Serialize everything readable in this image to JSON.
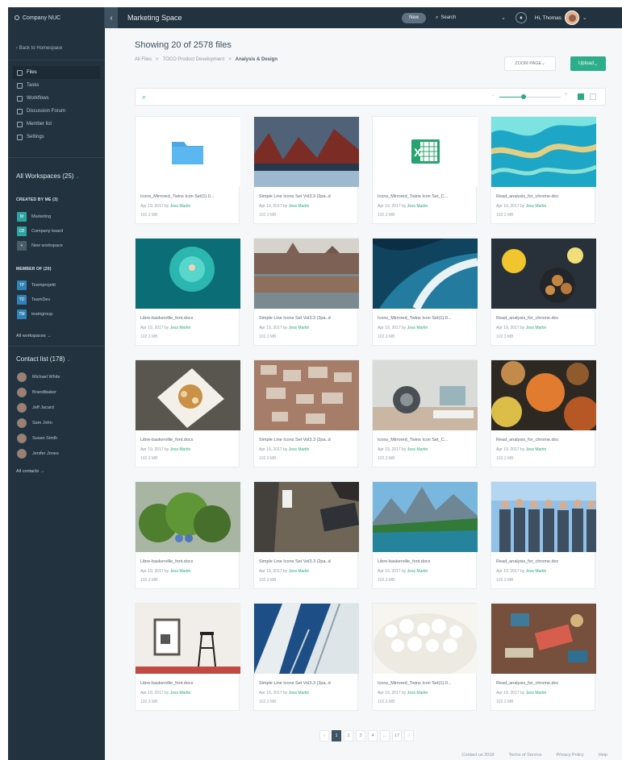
{
  "topbar": {
    "company": "Company NUC",
    "space": "Marketing Space",
    "new_label": "New",
    "search_label": "Search",
    "greeting": "Hi, Thomas"
  },
  "sidebar": {
    "back_label": "Back to Homespace",
    "nav": [
      {
        "label": "Files",
        "active": true,
        "icon": "file-icon"
      },
      {
        "label": "Tasks",
        "icon": "task-icon"
      },
      {
        "label": "Workflows",
        "icon": "workflow-icon"
      },
      {
        "label": "Discussion Forum",
        "icon": "discussion-icon"
      },
      {
        "label": "Member list",
        "icon": "member-icon"
      },
      {
        "label": "Settings",
        "icon": "gear-icon"
      }
    ],
    "workspaces_title": "All Workspaces (25)",
    "created_label": "CREATED BY ME (3)",
    "created": [
      {
        "initials": "M",
        "name": "Marketing",
        "color": "#2ea4a0"
      },
      {
        "initials": "CB",
        "name": "Company board",
        "color": "#2ea4a0"
      },
      {
        "initials": "+",
        "name": "New workspace",
        "color": "#4b5d6b"
      }
    ],
    "member_label": "MEMBER OF (20)",
    "member": [
      {
        "initials": "TP",
        "name": "Teamprojekt",
        "color": "#2f83b6"
      },
      {
        "initials": "TD",
        "name": "TeamDev",
        "color": "#2f83b6"
      },
      {
        "initials": "TM",
        "name": "teamgroup",
        "color": "#2f83b6"
      }
    ],
    "all_workspaces": "All workspaces →",
    "contacts_title": "Contact list (178)",
    "contacts": [
      "Michael White",
      "Brandtbaker",
      "Jeff Jacard",
      "Sam John",
      "Susan Smith",
      "Jenifer Jones"
    ],
    "all_contacts": "All contacts →"
  },
  "header": {
    "title": "Showing 20 of 2578 files",
    "breadcrumb": [
      "All Files",
      ">",
      "TOCO Product Development",
      ">",
      "Analysis & Design"
    ],
    "sort_label": "ZOOM PAGE",
    "upload_label": "Upload"
  },
  "toolbar": {
    "zoom_minus": "−",
    "zoom_plus": "+",
    "zoom_level": 0.4
  },
  "files": [
    {
      "name": "Icons_Mirrored_Twins Icon Set(1).0...",
      "date": "Apr 19, 2017 by",
      "author": "Jess Martin",
      "size": "102.3 MB",
      "kind": "folder"
    },
    {
      "name": "Simple Line Icons Set Vol3.3 (2pa..d",
      "date": "Apr 19, 2017 by",
      "author": "Jess Martin",
      "size": "102.3 MB",
      "kind": "image",
      "theme": "mountain"
    },
    {
      "name": "Icons_Mirrored_Twins Icon Set_C...",
      "date": "Apr 19, 2017 by",
      "author": "Jess Martin",
      "size": "102.3 MB",
      "kind": "excel"
    },
    {
      "name": "Read_analysis_for_chrome.doc",
      "date": "Apr 19, 2017 by",
      "author": "Jess Martin",
      "size": "102.3 MB",
      "kind": "image",
      "theme": "reef"
    },
    {
      "name": "Libre-baskerville_font.docx",
      "date": "Apr 19, 2017 by",
      "author": "Jess Martin",
      "size": "102.3 MB",
      "kind": "image",
      "theme": "swim"
    },
    {
      "name": "Simple Line Icons Set Vol3.3 (2pa..d",
      "date": "Apr 19, 2017 by",
      "author": "Jess Martin",
      "size": "102.3 MB",
      "kind": "image",
      "theme": "city"
    },
    {
      "name": "Icons_Mirrored_Twins Icon Set(1).0...",
      "date": "Apr 19, 2017 by",
      "author": "Jess Martin",
      "size": "102.3 MB",
      "kind": "image",
      "theme": "wave"
    },
    {
      "name": "Read_analysis_for_chrome.doc",
      "date": "Apr 19, 2017 by",
      "author": "Jess Martin",
      "size": "102.3 MB",
      "kind": "image",
      "theme": "food1"
    },
    {
      "name": "Libre-baskerville_font.docx",
      "date": "Apr 19, 2017 by",
      "author": "Jess Martin",
      "size": "102.3 MB",
      "kind": "image",
      "theme": "plate"
    },
    {
      "name": "Simple Line Icons Set Vol3.3 (2pa..d",
      "date": "Apr 19, 2017 by",
      "author": "Jess Martin",
      "size": "102.3 MB",
      "kind": "image",
      "theme": "paper"
    },
    {
      "name": "Icons_Mirrored_Twins Icon Set_C...",
      "date": "Apr 19, 2017 by",
      "author": "Jess Martin",
      "size": "102.3 MB",
      "kind": "image",
      "theme": "desk"
    },
    {
      "name": "Read_analysis_for_chrome.doc",
      "date": "Apr 19, 2017 by",
      "author": "Jess Martin",
      "size": "102.3 MB",
      "kind": "image",
      "theme": "curry"
    },
    {
      "name": "Libre-baskerville_font.docx",
      "date": "Apr 19, 2017 by",
      "author": "Jess Martin",
      "size": "102.3 MB",
      "kind": "image",
      "theme": "plant"
    },
    {
      "name": "Simple Line Icons Set Vol3.3 (2pa..d",
      "date": "Apr 19, 2017 by",
      "author": "Jess Martin",
      "size": "102.3 MB",
      "kind": "image",
      "theme": "laptop"
    },
    {
      "name": "Libre-baskerville_font.docx",
      "date": "Apr 19, 2017 by",
      "author": "Jess Martin",
      "size": "102.3 MB",
      "kind": "image",
      "theme": "lake"
    },
    {
      "name": "Read_analysis_for_chrome.doc",
      "date": "Apr 19, 2017 by",
      "author": "Jess Martin",
      "size": "102.3 MB",
      "kind": "image",
      "theme": "people"
    },
    {
      "name": "Libre-baskerville_font.docx",
      "date": "Apr 19, 2017 by",
      "author": "Jess Martin",
      "size": "102.3 MB",
      "kind": "image",
      "theme": "room"
    },
    {
      "name": "Simple Line Icons Set Vol3.3 (2pa..d",
      "date": "Apr 19, 2017 by",
      "author": "Jess Martin",
      "size": "102.3 MB",
      "kind": "image",
      "theme": "building"
    },
    {
      "name": "Icons_Mirrored_Twins Icon Set(1).0...",
      "date": "Apr 19, 2017 by",
      "author": "Jess Martin",
      "size": "102.3 MB",
      "kind": "image",
      "theme": "popcorn"
    },
    {
      "name": "Read_analysis_for_chrome.doc",
      "date": "Apr 19, 2017 by",
      "author": "Jess Martin",
      "size": "102.3 MB",
      "kind": "image",
      "theme": "tools"
    }
  ],
  "pagination": [
    "‹",
    "1",
    "2",
    "3",
    "4",
    "...",
    "17",
    "›"
  ],
  "footer": [
    "Contact us 2018",
    "Terms of Service",
    "Privacy Policy",
    "Help"
  ],
  "colors": {
    "accent": "#2dae8a",
    "sidebar": "#22333f"
  }
}
